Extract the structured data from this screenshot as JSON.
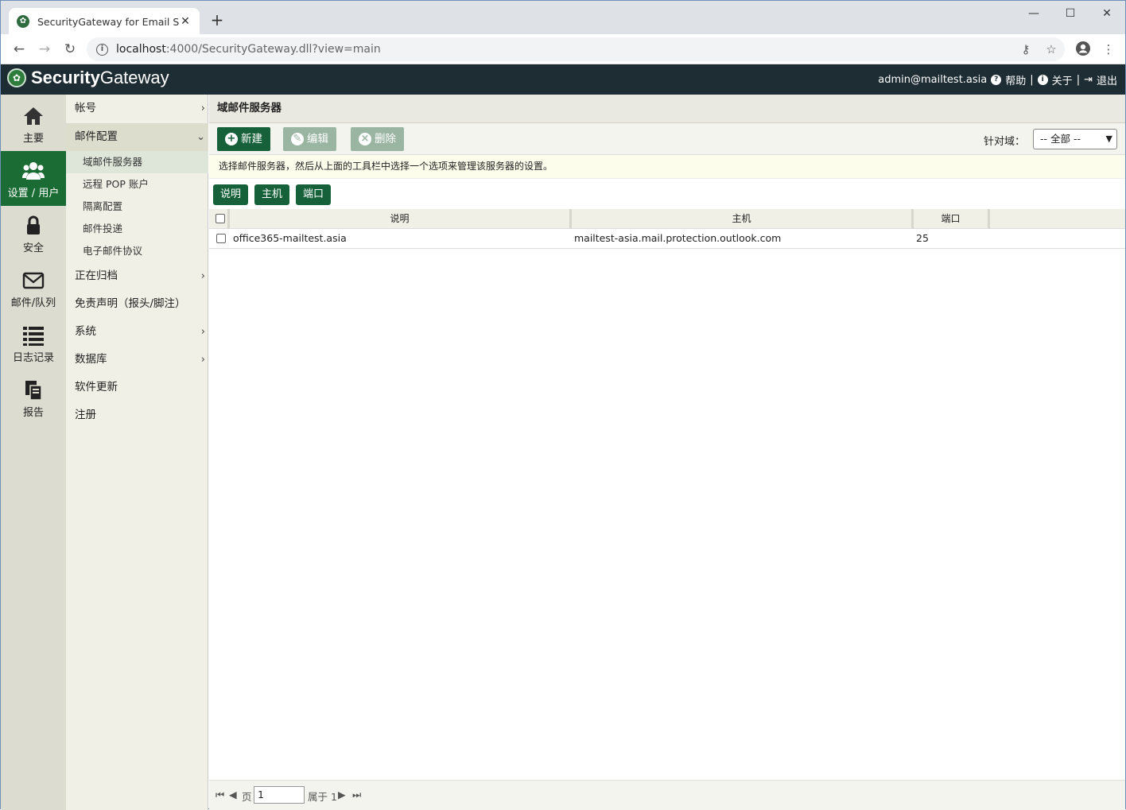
{
  "browser": {
    "tab_title": "SecurityGateway for Email Ser",
    "url_host": "localhost",
    "url_rest": ":4000/SecurityGateway.dll?view=main",
    "minimize": "—",
    "maximize": "☐",
    "close": "✕"
  },
  "app": {
    "brand_a": "Security",
    "brand_b": "Gateway",
    "user": "admin@mailtest.asia",
    "help": "帮助",
    "about": "关于",
    "logout": "退出",
    "sep": "|"
  },
  "rail": [
    {
      "label": "主要",
      "icon": "home-icon"
    },
    {
      "label": "设置 / 用户",
      "icon": "users-icon"
    },
    {
      "label": "安全",
      "icon": "lock-icon"
    },
    {
      "label": "邮件/队列",
      "icon": "envelope-icon"
    },
    {
      "label": "日志记录",
      "icon": "list-icon"
    },
    {
      "label": "报告",
      "icon": "report-icon"
    }
  ],
  "menu": {
    "accounts": "帐号",
    "mail_config": "邮件配置",
    "sub": [
      "域邮件服务器",
      "远程 POP 账户",
      "隔离配置",
      "邮件投递",
      "电子邮件协议"
    ],
    "archiving": "正在归档",
    "disclaimer": "免责声明（报头/脚注）",
    "system": "系统",
    "database": "数据库",
    "updates": "软件更新",
    "register": "注册"
  },
  "main": {
    "title": "域邮件服务器",
    "btn_new": "新建",
    "btn_edit": "编辑",
    "btn_delete": "删除",
    "domain_label": "针对域：",
    "domain_value": "-- 全部 --",
    "hint": "选择邮件服务器，然后从上面的工具栏中选择一个选项来管理该服务器的设置。",
    "col_buttons": [
      "说明",
      "主机",
      "端口"
    ],
    "columns": [
      "说明",
      "主机",
      "端口"
    ],
    "rows": [
      {
        "desc": "office365-mailtest.asia",
        "host": "mailtest-asia.mail.protection.outlook.com",
        "port": "25"
      }
    ]
  },
  "pager": {
    "page_label": "页",
    "page_value": "1",
    "of_label": "属于 1"
  },
  "colors": {
    "accent": "#17613a",
    "appbar": "#1e2d34"
  }
}
